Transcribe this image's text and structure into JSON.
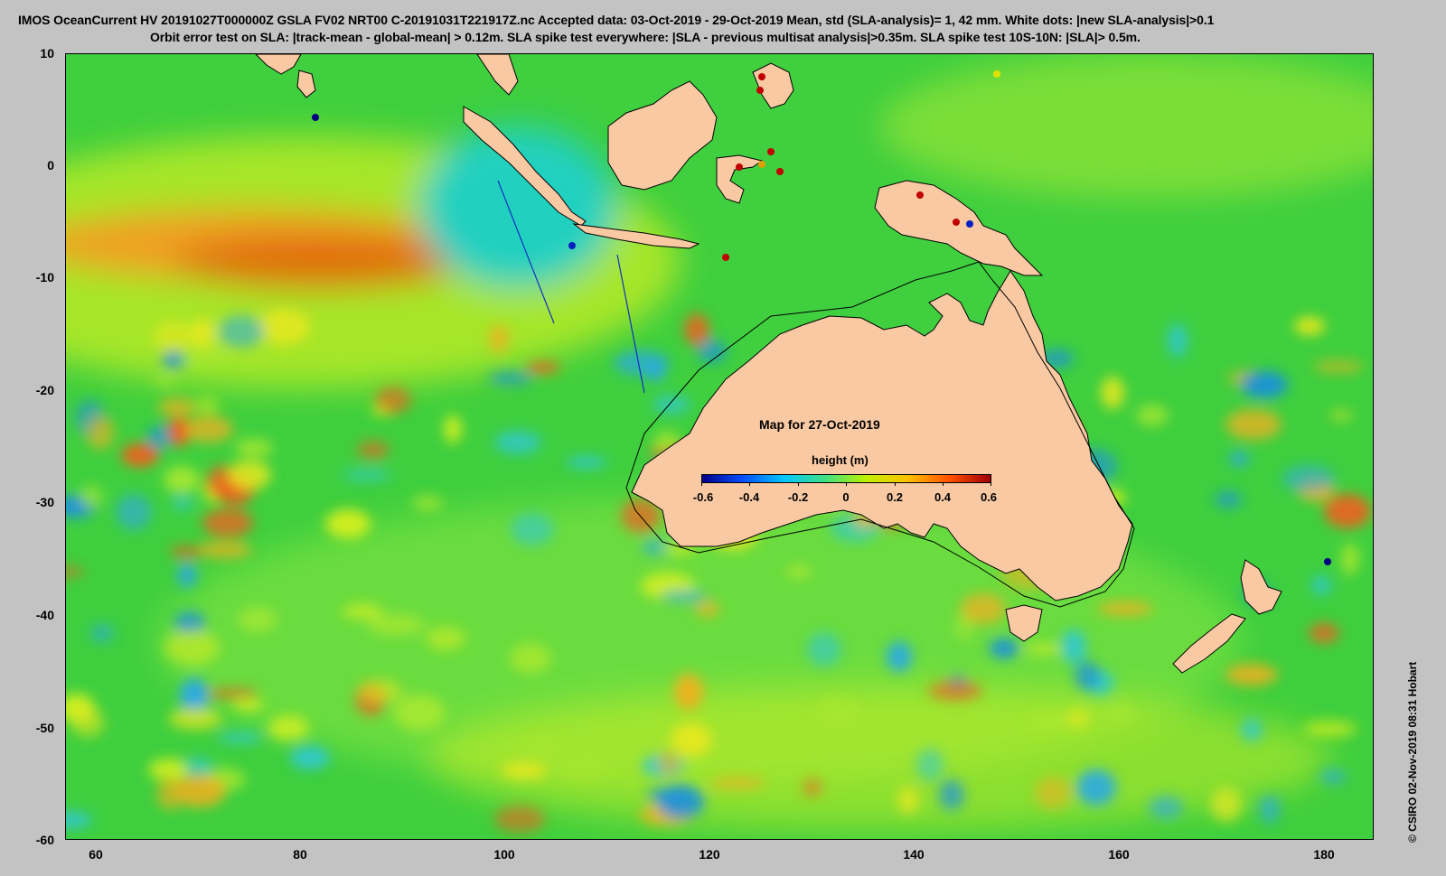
{
  "header": {
    "line1": "IMOS OceanCurrent HV 20191027T000000Z GSLA FV02 NRT00 C-20191031T221917Z.nc  Accepted data: 03-Oct-2019 - 29-Oct-2019 Mean, std (SLA-analysis)= 1, 42 mm. White dots: |new SLA-analysis|>0.1",
    "line2": "Orbit error test on SLA: |track-mean  - global-mean| > 0.12m.  SLA spike test everywhere: |SLA - previous multisat analysis|>0.35m. SLA spike test 10S-10N: |SLA|> 0.5m."
  },
  "map": {
    "date_label": "Map for 27-Oct-2019",
    "lon_range": [
      57,
      185
    ],
    "lat_range": [
      -60,
      10
    ],
    "x_ticks": [
      "60",
      "80",
      "100",
      "120",
      "140",
      "160",
      "180"
    ],
    "y_ticks": [
      "10",
      "0",
      "-10",
      "-20",
      "-30",
      "-40",
      "-50",
      "-60"
    ],
    "land_color": "#f9c9a3",
    "ocean_base_color": "#3fcf3f"
  },
  "colorbar": {
    "title": "height (m)",
    "ticks": [
      "-0.6",
      "-0.4",
      "-0.2",
      "0",
      "0.2",
      "0.4",
      "0.6"
    ],
    "colors": [
      "#00008b",
      "#0050ff",
      "#00c8ff",
      "#40e080",
      "#c0f000",
      "#ffc000",
      "#ff5000",
      "#a00000"
    ]
  },
  "credit": "© CSIRO 02-Nov-2019 08:31 Hobart"
}
